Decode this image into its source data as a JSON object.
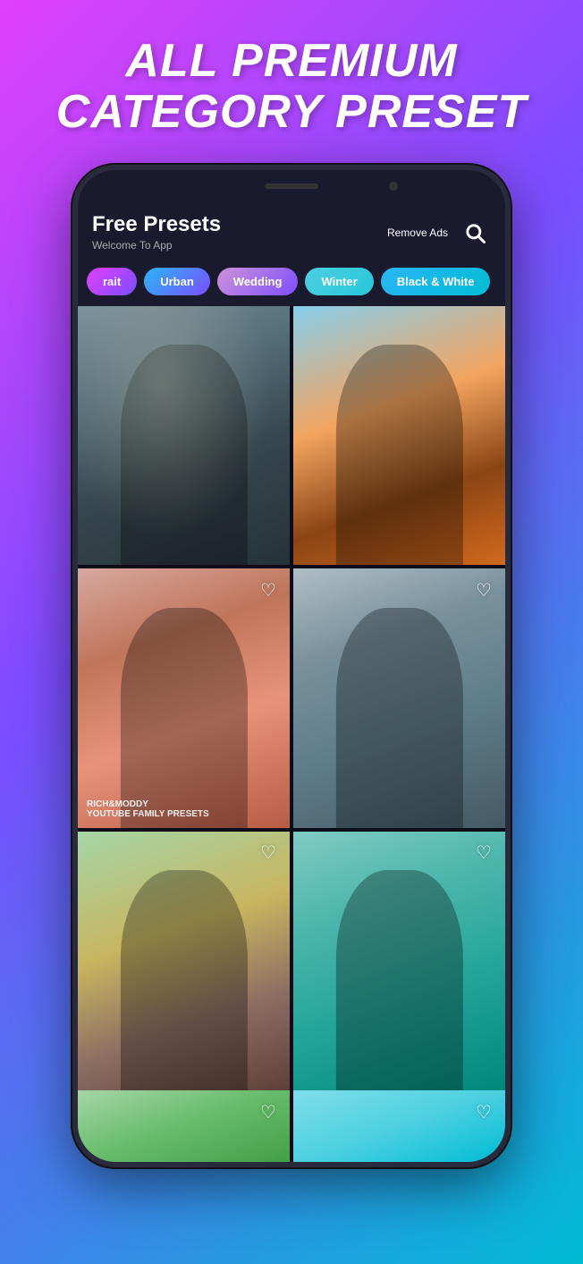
{
  "background": {
    "gradient_start": "#e040fb",
    "gradient_end": "#00bcd4"
  },
  "hero": {
    "line1": "ALL PREMIUM",
    "line2": "CATEGORY PRESET"
  },
  "app": {
    "title": "Free Presets",
    "subtitle": "Welcome To App",
    "remove_ads_label": "Remove Ads"
  },
  "search": {
    "icon_label": "search"
  },
  "categories": [
    {
      "id": "portrait",
      "label": "rait",
      "style": "pill-gradient-1"
    },
    {
      "id": "urban",
      "label": "Urban",
      "style": "pill-gradient-2"
    },
    {
      "id": "wedding",
      "label": "Wedding",
      "style": "pill-gradient-3"
    },
    {
      "id": "winter",
      "label": "Winter",
      "style": "pill-gradient-4"
    },
    {
      "id": "blackwhite",
      "label": "Black & White",
      "style": "pill-gradient-5"
    }
  ],
  "grid_items": [
    {
      "id": 1,
      "photo_class": "photo-1",
      "show_heart": false,
      "label": ""
    },
    {
      "id": 2,
      "photo_class": "photo-2",
      "show_heart": false,
      "label": ""
    },
    {
      "id": 3,
      "photo_class": "photo-3",
      "show_heart": true,
      "label": "RICH&MODDY\nYOUTUBE FAMILY PRESETS"
    },
    {
      "id": 4,
      "photo_class": "photo-4",
      "show_heart": true,
      "label": ""
    },
    {
      "id": 5,
      "photo_class": "photo-5",
      "show_heart": true,
      "label": ""
    },
    {
      "id": 6,
      "photo_class": "photo-6",
      "show_heart": true,
      "label": ""
    }
  ],
  "bottom_items": [
    {
      "id": 7,
      "photo_class": "photo-bottom-1",
      "show_heart": true
    },
    {
      "id": 8,
      "photo_class": "photo-bottom-2",
      "show_heart": true
    }
  ],
  "heart_icon": "♡"
}
